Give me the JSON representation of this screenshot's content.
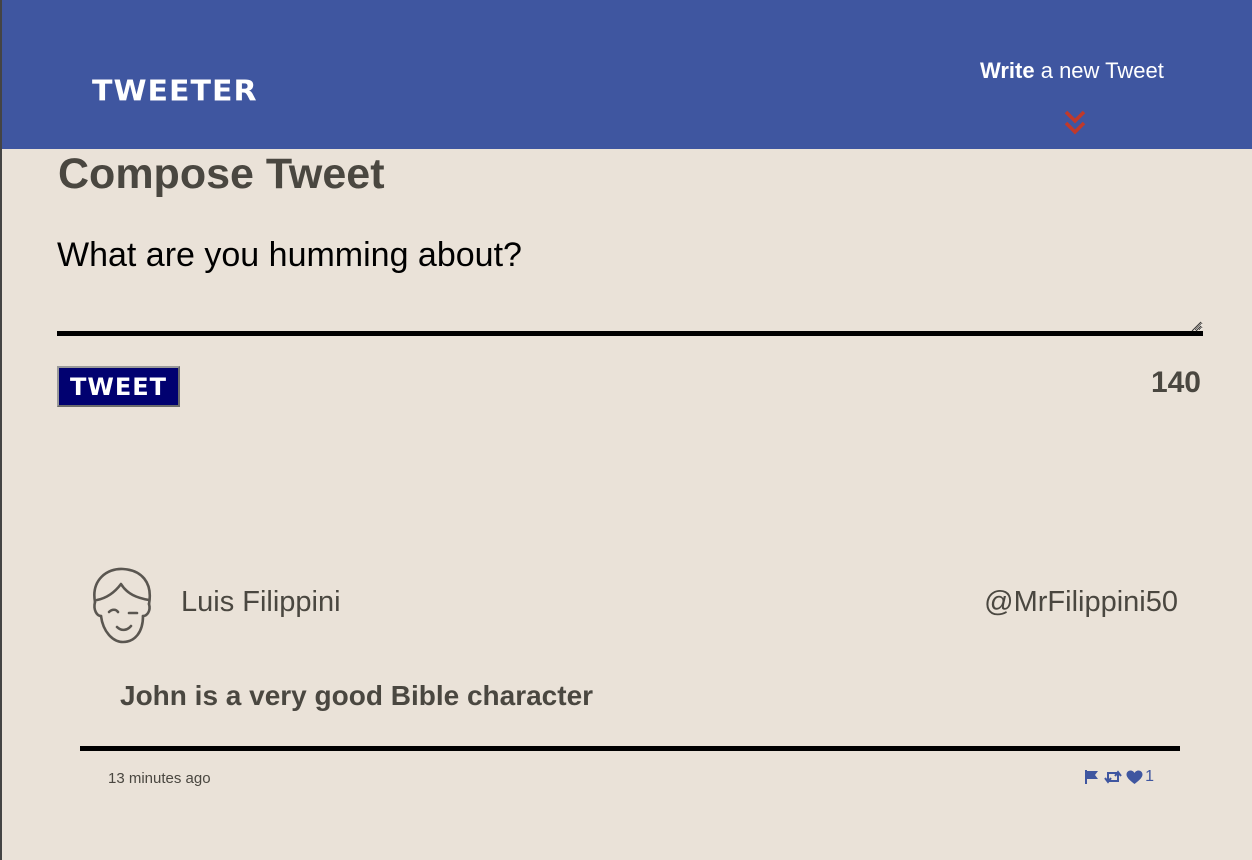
{
  "nav": {
    "brand": "Tweeter",
    "compose_bold": "Write",
    "compose_rest": " a new Tweet",
    "chevron_icon": "double-chevron-down-icon",
    "colors": {
      "background": "#3f56a0",
      "chevron": "#c0392b"
    }
  },
  "compose": {
    "title": "Compose Tweet",
    "placeholder": "What are you humming about?",
    "value": "",
    "button_label": "Tweet",
    "counter": "140"
  },
  "tweets": [
    {
      "avatar_icon": "winking-face-avatar-icon",
      "name": "Luis Filippini",
      "handle": "@MrFilippini50",
      "content": "John is a very good Bible character",
      "timestamp": "13 minutes ago",
      "actions": {
        "flag_icon": "flag-icon",
        "retweet_icon": "retweet-icon",
        "like_icon": "heart-icon",
        "like_count": "1"
      }
    }
  ],
  "colors": {
    "page_background": "#eae2d8",
    "text": "#4a4740",
    "button": "#010170",
    "accent": "#3f56a0"
  }
}
